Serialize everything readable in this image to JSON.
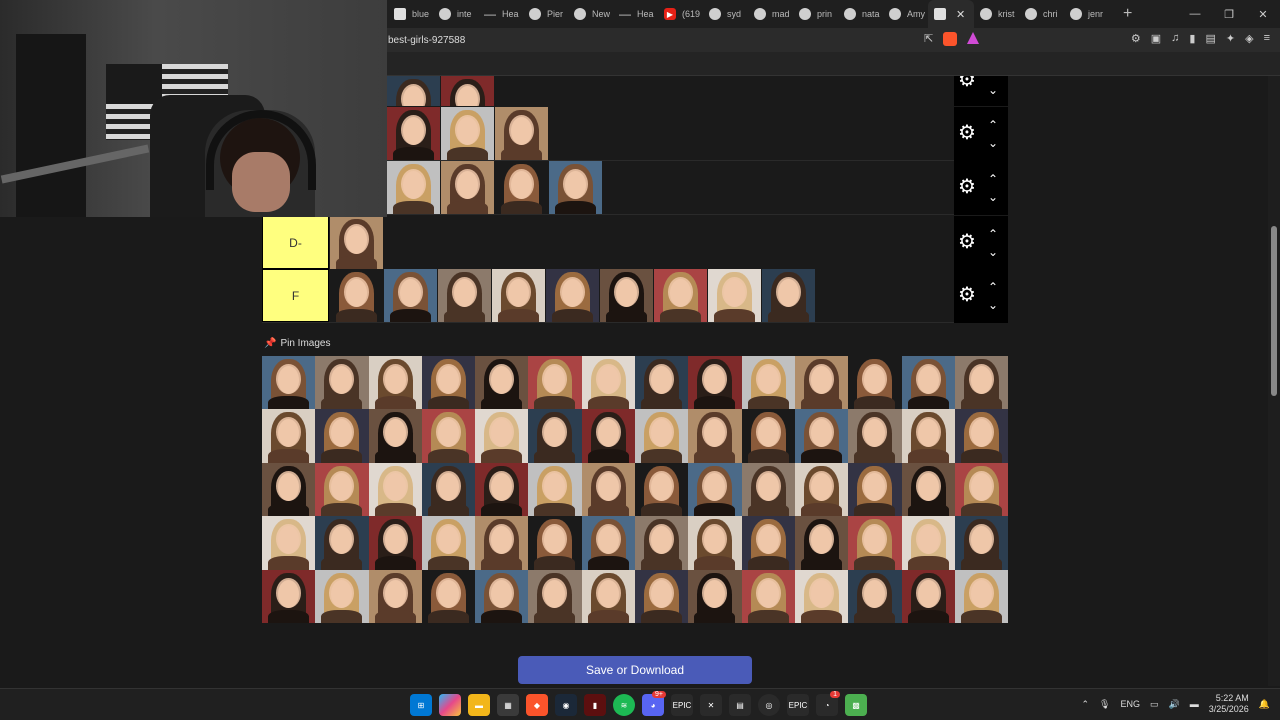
{
  "tabs": [
    {
      "label": "blue",
      "icon": "doc-icon"
    },
    {
      "label": "inte",
      "icon": "chrome-icon"
    },
    {
      "label": "Hea",
      "icon": "dash-icon"
    },
    {
      "label": "Pier",
      "icon": "chrome-icon"
    },
    {
      "label": "New",
      "icon": "chrome-icon"
    },
    {
      "label": "Hea",
      "icon": "dash-icon"
    },
    {
      "label": "(619",
      "icon": "youtube-icon"
    },
    {
      "label": "syd",
      "icon": "chrome-icon"
    },
    {
      "label": "mad",
      "icon": "chrome-icon"
    },
    {
      "label": "prin",
      "icon": "chrome-icon"
    },
    {
      "label": "nata",
      "icon": "chrome-icon"
    },
    {
      "label": "Amy",
      "icon": "chrome-icon"
    },
    {
      "label": "",
      "icon": "doc-icon",
      "active": true
    },
    {
      "label": "krist",
      "icon": "chrome-icon"
    },
    {
      "label": "chri",
      "icon": "chrome-icon"
    },
    {
      "label": "jenr",
      "icon": "chrome-icon"
    }
  ],
  "address": {
    "url": "best-girls-927588"
  },
  "tiers": [
    {
      "label": "",
      "count": 2
    },
    {
      "label": "",
      "count": 3
    },
    {
      "label": "",
      "count": 4
    },
    {
      "label": "D-",
      "count": 1
    },
    {
      "label": "F",
      "count": 9
    }
  ],
  "pin_label": "Pin Images",
  "pool_count": 70,
  "save_button": "Save or Download",
  "taskbar": {
    "language": "ENG",
    "time": "5:22 AM",
    "date": "3/25/2026",
    "discord_badge": "9+",
    "notif_badge": "1"
  },
  "colors": {
    "tier_label_bg": "#ffff7f",
    "save_button_bg": "#4a5bb8",
    "page_bg": "#1a1a1a"
  }
}
